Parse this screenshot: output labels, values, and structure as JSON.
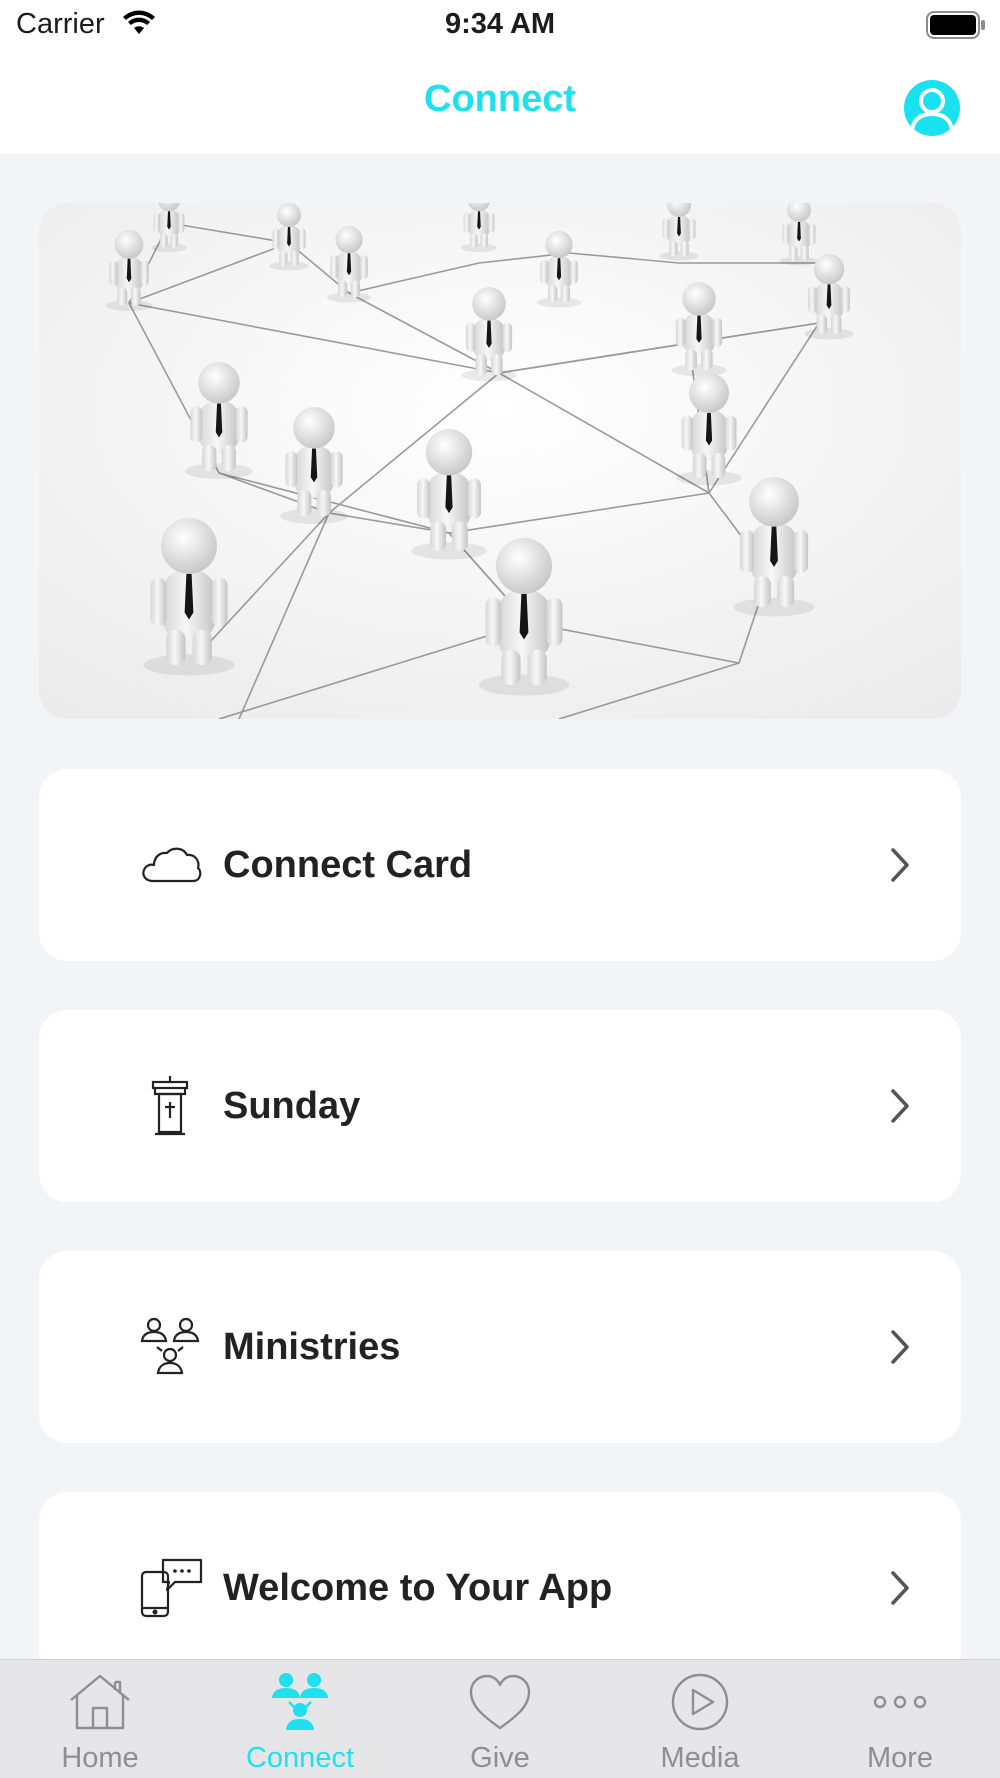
{
  "status_bar": {
    "carrier": "Carrier",
    "time": "9:34 AM"
  },
  "nav": {
    "title": "Connect",
    "accent_color": "#1EE0EF"
  },
  "hero": {
    "image": "network-of-people-illustration"
  },
  "list": [
    {
      "label": "Connect Card",
      "icon": "cloud-icon"
    },
    {
      "label": "Sunday",
      "icon": "pulpit-icon"
    },
    {
      "label": "Ministries",
      "icon": "group-icon"
    },
    {
      "label": "Welcome to Your App",
      "icon": "phone-chat-icon"
    }
  ],
  "tabs": [
    {
      "label": "Home",
      "icon": "home-icon",
      "active": false
    },
    {
      "label": "Connect",
      "icon": "people-icon",
      "active": true
    },
    {
      "label": "Give",
      "icon": "heart-icon",
      "active": false
    },
    {
      "label": "Media",
      "icon": "play-icon",
      "active": false
    },
    {
      "label": "More",
      "icon": "more-icon",
      "active": false
    }
  ]
}
